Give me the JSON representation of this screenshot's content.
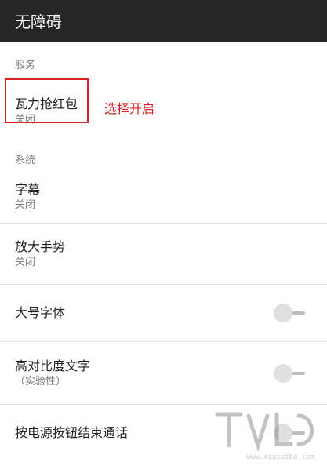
{
  "app": {
    "title": "无障碍"
  },
  "sections": [
    {
      "header": "服务",
      "items": [
        {
          "title": "瓦力抢红包",
          "subtitle": "关闭"
        }
      ]
    },
    {
      "header": "系统",
      "items": [
        {
          "title": "字幕",
          "subtitle": "关闭"
        },
        {
          "title": "放大手势",
          "subtitle": "关闭"
        },
        {
          "title": "大号字体",
          "toggle": false
        },
        {
          "title": "高对比度文字",
          "subtitle": "（实验性）",
          "toggle": false
        },
        {
          "title": "按电源按钮结束通话",
          "toggle": false
        }
      ]
    }
  ],
  "annotation": {
    "text": "选择开启",
    "color": "#d92121"
  },
  "watermark": {
    "url": "www.xiazaiba.com"
  },
  "colors": {
    "titlebar": "#262626",
    "highlight": "#d92121"
  }
}
